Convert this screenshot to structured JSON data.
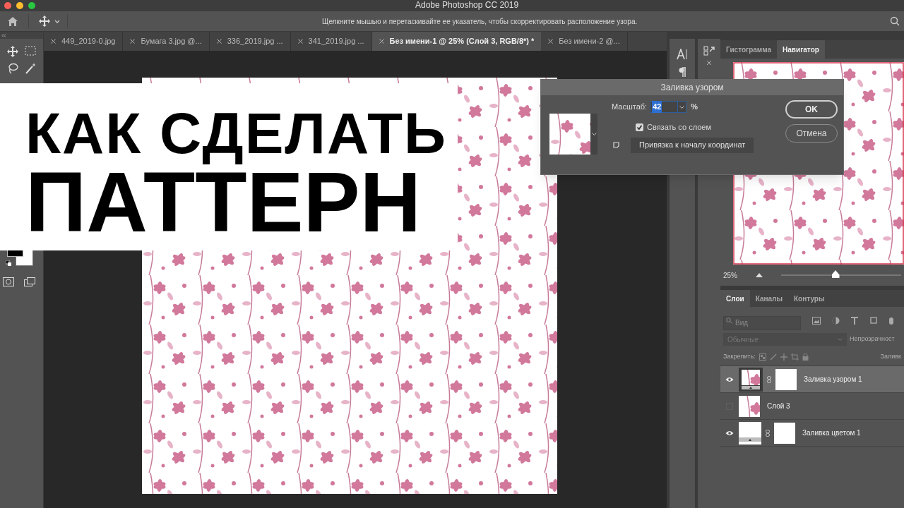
{
  "window": {
    "title": "Adobe Photoshop CC 2019"
  },
  "options_bar": {
    "hint": "Щелкните мышью и перетаскивайте ее указатель, чтобы скорректировать расположение узора."
  },
  "document_tabs": [
    {
      "label": "449_2019-0.jpg",
      "selected": false
    },
    {
      "label": "Бумага 3.jpg @...",
      "selected": false
    },
    {
      "label": "336_2019.jpg ...",
      "selected": false
    },
    {
      "label": "341_2019.jpg ...",
      "selected": false
    },
    {
      "label": "Без имени-1 @ 25% (Слой 3, RGB/8*) *",
      "selected": true
    },
    {
      "label": "Без имени-2 @...",
      "selected": false
    }
  ],
  "banner": {
    "lines": [
      "КАК СДЕЛАТЬ",
      "ПАТТЕРН"
    ]
  },
  "dialog": {
    "title": "Заливка узором",
    "scale_label": "Масштаб:",
    "scale_value": "42",
    "unit": "%",
    "link_checkbox": {
      "label": "Связать со слоем",
      "checked": true
    },
    "snap_button": "Привязка к началу координат",
    "buttons": [
      "OK",
      "Отмена"
    ]
  },
  "top_panel": {
    "tabs": [
      {
        "label": "Гистограмма",
        "selected": false
      },
      {
        "label": "Навигатор",
        "selected": true
      }
    ],
    "zoom": "25%",
    "level": 0.45
  },
  "layers_panel": {
    "tabs": [
      {
        "label": "Слои",
        "selected": true
      },
      {
        "label": "Каналы",
        "selected": false
      },
      {
        "label": "Контуры",
        "selected": false
      }
    ],
    "search_placeholder": "Вид",
    "blend_mode": "Обычные",
    "opacity_label": "Непрозрачност",
    "lock_label": "Закрепить:",
    "fill_label": "Заливк",
    "layers": [
      {
        "name": "Заливка узором 1",
        "kind": "pattern-fill",
        "visible": true,
        "selected": true
      },
      {
        "name": "Слой 3",
        "kind": "pixel",
        "visible": false,
        "selected": false
      },
      {
        "name": "Заливка цветом 1",
        "kind": "color-fill",
        "visible": true,
        "selected": false
      }
    ]
  }
}
